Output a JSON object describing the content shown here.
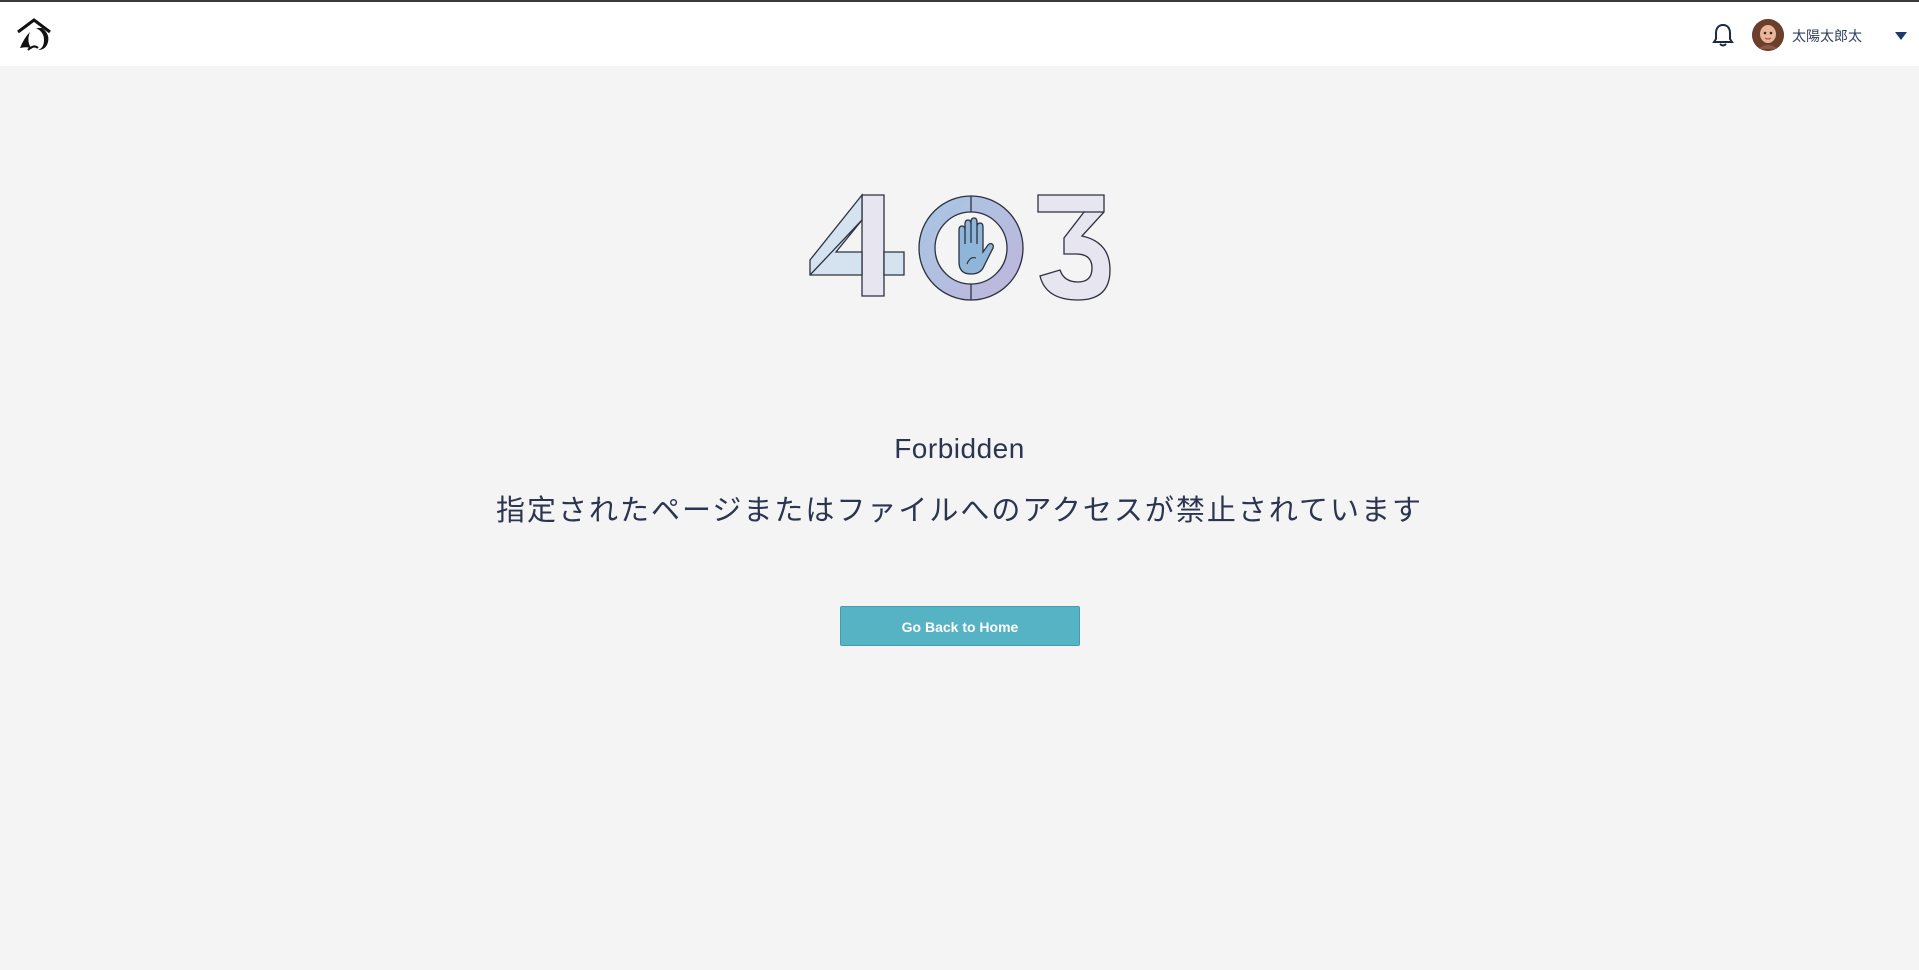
{
  "header": {
    "logo_icon": "house-logo-icon",
    "notification_icon": "bell-icon",
    "user": {
      "avatar_icon": "user-avatar",
      "name": "太陽太郎太",
      "menu_icon": "caret-down-icon"
    }
  },
  "error": {
    "code_illustration": "403-stop-hand-illustration",
    "title": "Forbidden",
    "message": "指定されたページまたはファイルへのアクセスが禁止されています"
  },
  "actions": {
    "home_button_label": "Go Back to Home"
  },
  "colors": {
    "background": "#f4f4f4",
    "header": "#ffffff",
    "button": "#55b3c4",
    "text": "#2b3550"
  }
}
